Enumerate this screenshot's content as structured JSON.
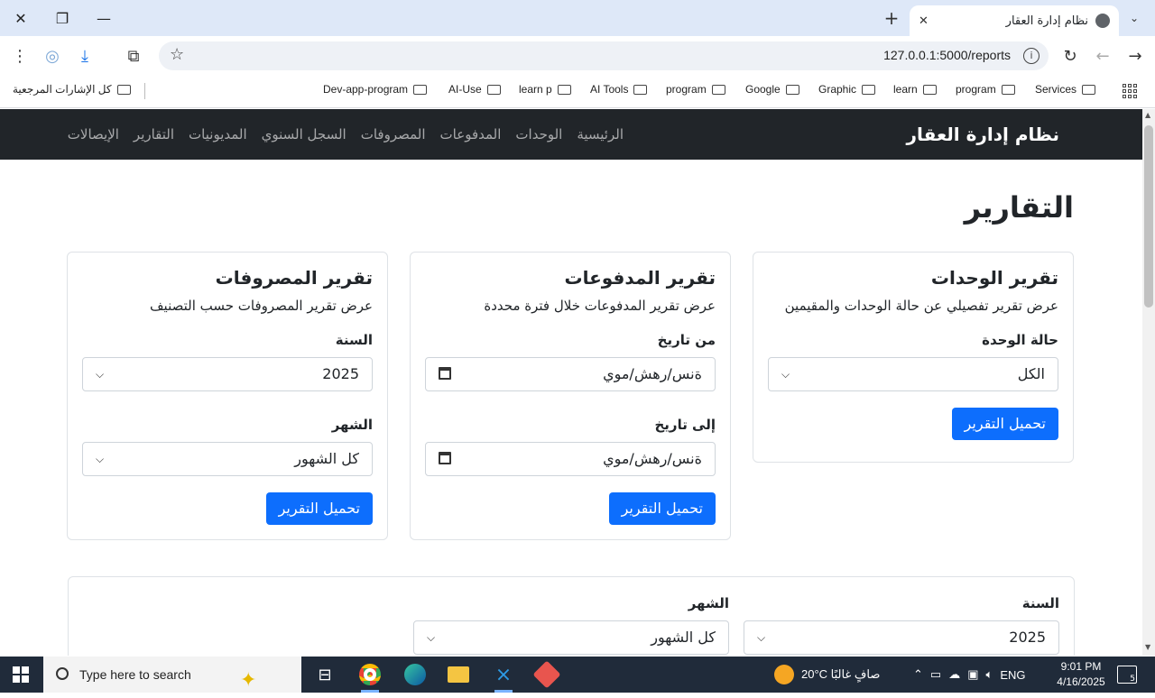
{
  "browser": {
    "tab_title": "نظام إدارة العقار",
    "url": "127.0.0.1:5000/reports",
    "bookmarks": [
      "Services",
      "program",
      "learn",
      "Graphic",
      "Google",
      "program",
      "AI Tools",
      "learn p",
      "AI-Use",
      "Dev-app-program"
    ],
    "all_bookmarks": "كل الإشارات المرجعية"
  },
  "navbar": {
    "brand": "نظام إدارة العقار",
    "links": [
      "الرئيسية",
      "الوحدات",
      "المدفوعات",
      "المصروفات",
      "السجل السنوي",
      "المديونيات",
      "التقارير",
      "الإيصالات"
    ]
  },
  "page_title": "التقارير",
  "units_report": {
    "title": "تقرير الوحدات",
    "desc": "عرض تقرير تفصيلي عن حالة الوحدات والمقيمين",
    "status_label": "حالة الوحدة",
    "status_value": "الكل",
    "button": "تحميل التقرير"
  },
  "payments_report": {
    "title": "تقرير المدفوعات",
    "desc": "عرض تقرير المدفوعات خلال فترة محددة",
    "from_label": "من تاريخ",
    "from_value": "ةنس/رهش/موي",
    "to_label": "إلى تاريخ",
    "to_value": "ةنس/رهش/موي",
    "button": "تحميل التقرير"
  },
  "expenses_report": {
    "title": "تقرير المصروفات",
    "desc": "عرض تقرير المصروفات حسب التصنيف",
    "year_label": "السنة",
    "year_value": "2025",
    "month_label": "الشهر",
    "month_value": "كل الشهور",
    "button": "تحميل التقرير"
  },
  "filter": {
    "year_label": "السنة",
    "year_value": "2025",
    "month_label": "الشهر",
    "month_value": "كل الشهور"
  },
  "taskbar": {
    "search_placeholder": "Type here to search",
    "weather": "20°C  صافٍ غالبًا",
    "lang": "ENG",
    "time": "9:01 PM",
    "date": "4/16/2025",
    "notifications": "5"
  }
}
